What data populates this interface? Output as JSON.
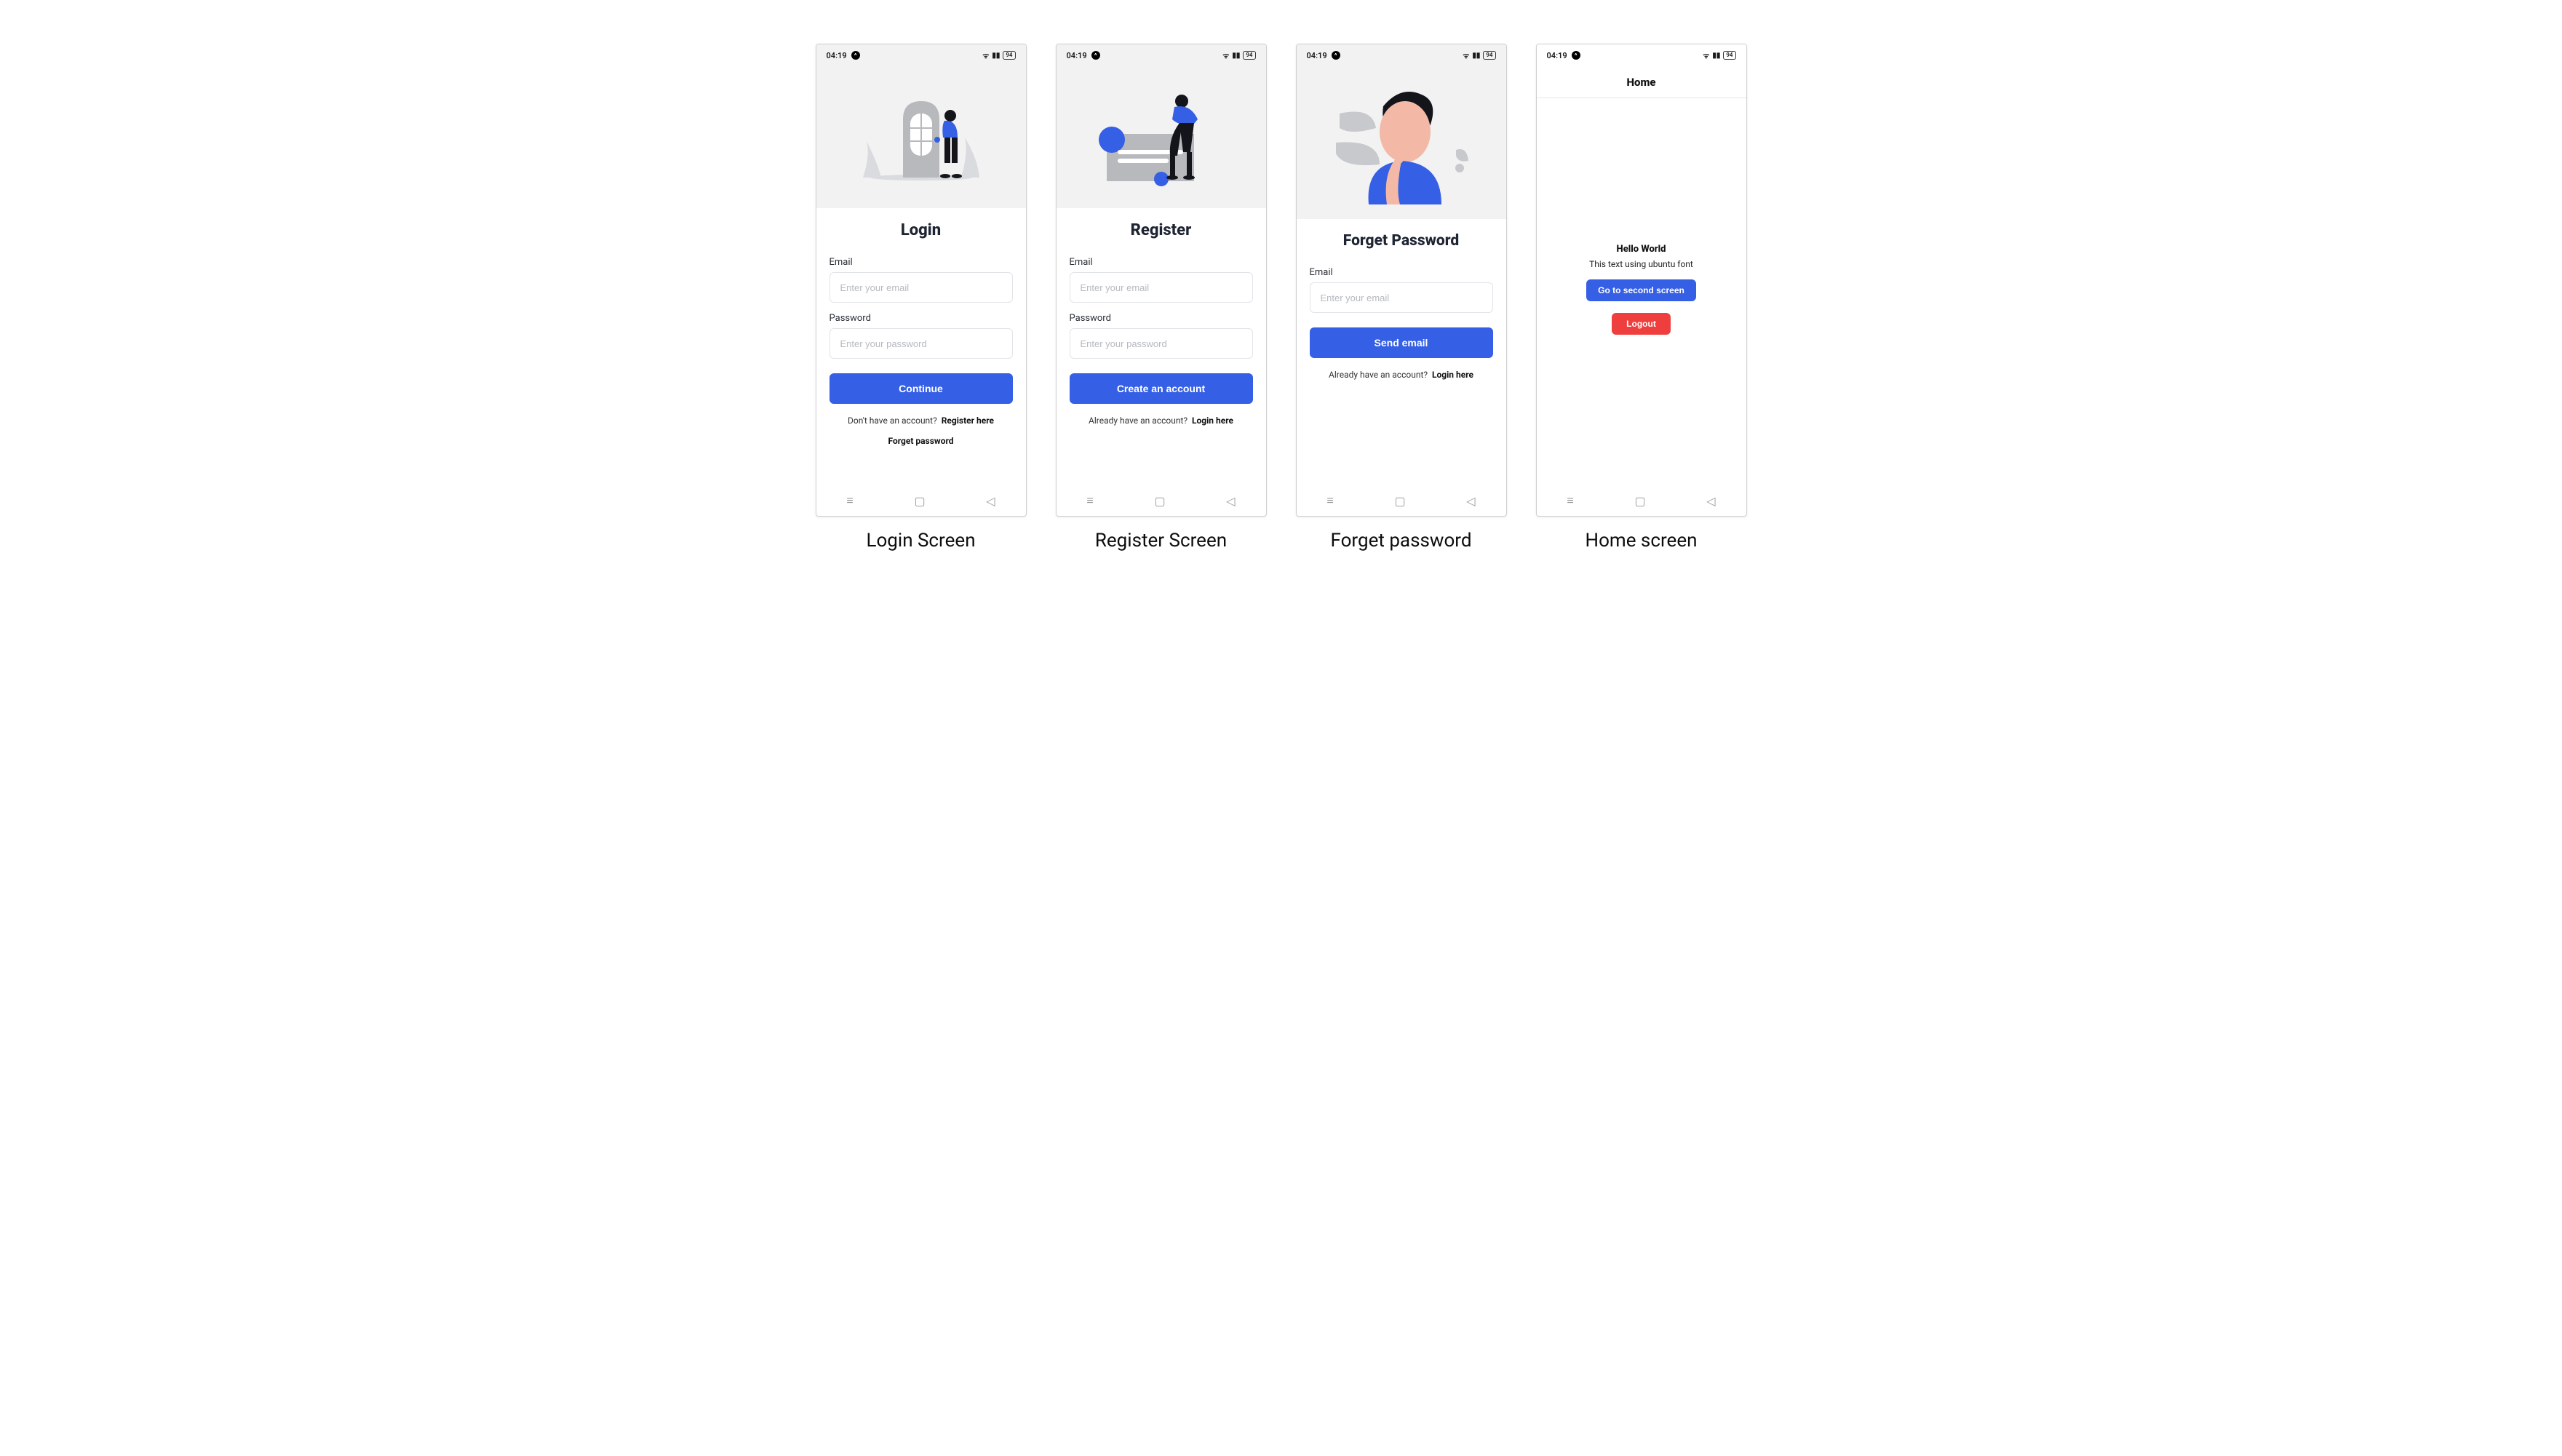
{
  "status": {
    "time": "04:19",
    "battery": "94"
  },
  "captions": {
    "login": "Login Screen",
    "register": "Register Screen",
    "forget": "Forget password",
    "home": "Home screen"
  },
  "login": {
    "title": "Login",
    "email_label": "Email",
    "email_ph": "Enter your email",
    "password_label": "Password",
    "password_ph": "Enter your password",
    "button": "Continue",
    "prompt": "Don't have an account?",
    "prompt_link": "Register here",
    "forgot": "Forget password"
  },
  "register": {
    "title": "Register",
    "email_label": "Email",
    "email_ph": "Enter your email",
    "password_label": "Password",
    "password_ph": "Enter your password",
    "button": "Create an account",
    "prompt": "Already have an account?",
    "prompt_link": "Login here"
  },
  "forget": {
    "title": "Forget Password",
    "email_label": "Email",
    "email_ph": "Enter your email",
    "button": "Send email",
    "prompt": "Already have an account?",
    "prompt_link": "Login here"
  },
  "home": {
    "appbar": "Home",
    "hello": "Hello World",
    "sub": "This text using ubuntu font",
    "btn1": "Go to second screen",
    "btn2": "Logout"
  }
}
